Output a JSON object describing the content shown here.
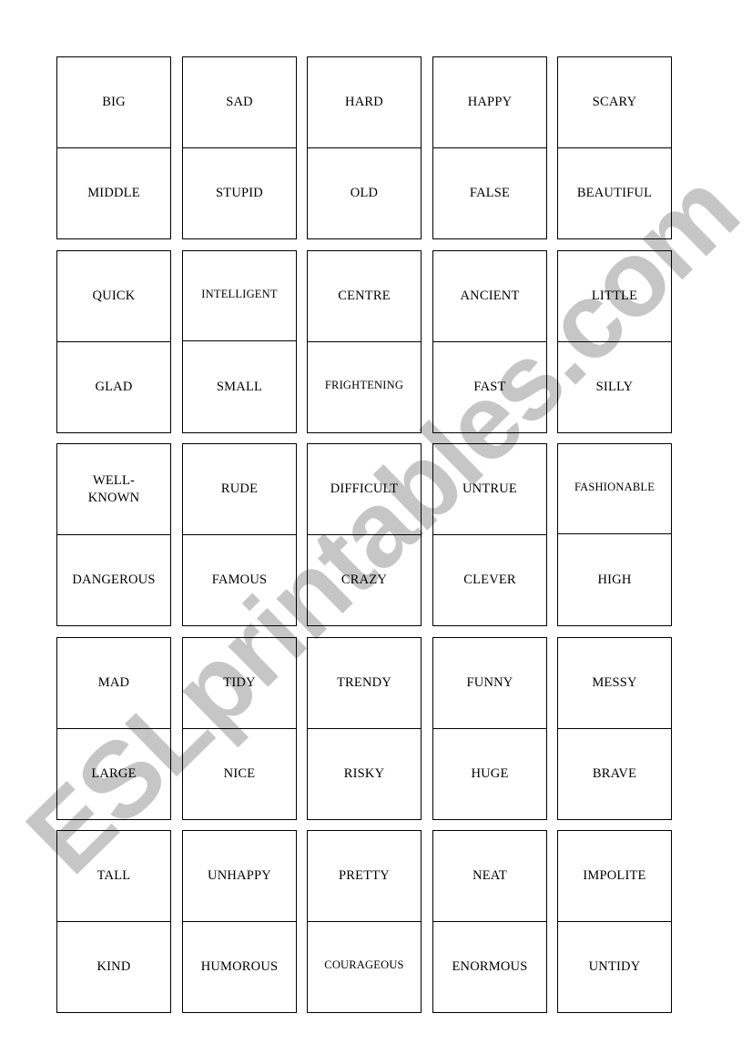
{
  "watermark": "ESLprintables.com",
  "colors": {
    "watermark": "#c6c6c6",
    "border": "#000000",
    "text": "#000000",
    "page": "#ffffff"
  },
  "cards": [
    [
      {
        "top": "BIG",
        "bottom": "MIDDLE"
      },
      {
        "top": "SAD",
        "bottom": "STUPID"
      },
      {
        "top": "HARD",
        "bottom": "OLD"
      },
      {
        "top": "HAPPY",
        "bottom": "FALSE"
      },
      {
        "top": "SCARY",
        "bottom": "BEAUTIFUL"
      }
    ],
    [
      {
        "top": "QUICK",
        "bottom": "GLAD"
      },
      {
        "top": "INTELLIGENT",
        "bottom": "SMALL"
      },
      {
        "top": "CENTRE",
        "bottom": "FRIGHTENING"
      },
      {
        "top": "ANCIENT",
        "bottom": "FAST"
      },
      {
        "top": "LITTLE",
        "bottom": "SILLY"
      }
    ],
    [
      {
        "top": "WELL-KNOWN",
        "bottom": "DANGEROUS"
      },
      {
        "top": "RUDE",
        "bottom": "FAMOUS"
      },
      {
        "top": "DIFFICULT",
        "bottom": "CRAZY"
      },
      {
        "top": "UNTRUE",
        "bottom": "CLEVER"
      },
      {
        "top": "FASHIONABLE",
        "bottom": "HIGH"
      }
    ],
    [
      {
        "top": "MAD",
        "bottom": "LARGE"
      },
      {
        "top": "TIDY",
        "bottom": "NICE"
      },
      {
        "top": "TRENDY",
        "bottom": "RISKY"
      },
      {
        "top": "FUNNY",
        "bottom": "HUGE"
      },
      {
        "top": "MESSY",
        "bottom": "BRAVE"
      }
    ],
    [
      {
        "top": "TALL",
        "bottom": "KIND"
      },
      {
        "top": "UNHAPPY",
        "bottom": "HUMOROUS"
      },
      {
        "top": "PRETTY",
        "bottom": "COURAGEOUS"
      },
      {
        "top": "NEAT",
        "bottom": "ENORMOUS"
      },
      {
        "top": "IMPOLITE",
        "bottom": "UNTIDY"
      }
    ]
  ]
}
